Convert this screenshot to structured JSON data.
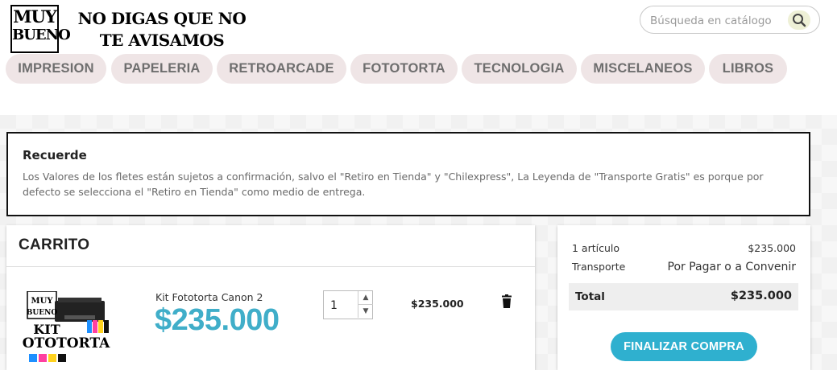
{
  "logo": {
    "line1": "MUY",
    "line2": "BUENO"
  },
  "tagline": {
    "line1": "NO DIGAS QUE NO",
    "line2": "TE AVISAMOS"
  },
  "search": {
    "placeholder": "Búsqueda en catálogo",
    "value": "",
    "icon": "search-icon"
  },
  "nav": {
    "items": [
      {
        "label": "IMPRESION"
      },
      {
        "label": "PAPELERIA"
      },
      {
        "label": "RETROARCADE"
      },
      {
        "label": "FOTOTORTA"
      },
      {
        "label": "TECNOLOGIA"
      },
      {
        "label": "MISCELANEOS"
      },
      {
        "label": "LIBROS"
      }
    ]
  },
  "notice": {
    "title": "Recuerde",
    "body": "Los Valores de los fletes están sujetos a confirmación, salvo el \"Retiro en Tienda\" y \"Chilexpress\", La Leyenda de \"Transporte Gratis\" es porque por defecto se selecciona el \"Retiro en Tienda\" como medio de entrega."
  },
  "cart": {
    "title": "CARRITO",
    "item": {
      "image_text": {
        "brand1": "MUY",
        "brand2": "BUENO",
        "kit": "KIT",
        "product": "FOTOTORTA"
      },
      "name": "Kit Fototorta Canon 2",
      "price": "$235.000",
      "quantity": "1",
      "line_total": "$235.000",
      "remove_icon": "trash-icon"
    }
  },
  "summary": {
    "items_label": "1 artículo",
    "items_value": "$235.000",
    "shipping_label": "Transporte",
    "shipping_value": "Por Pagar o a Convenir",
    "total_label": "Total",
    "total_value": "$235.000",
    "checkout_label": "FINALIZAR COMPRA"
  },
  "colors": {
    "accent": "#2fb0cf",
    "price": "#40aec9",
    "nav_bg": "#efe5e6",
    "nav_text": "#6e6e6e"
  }
}
